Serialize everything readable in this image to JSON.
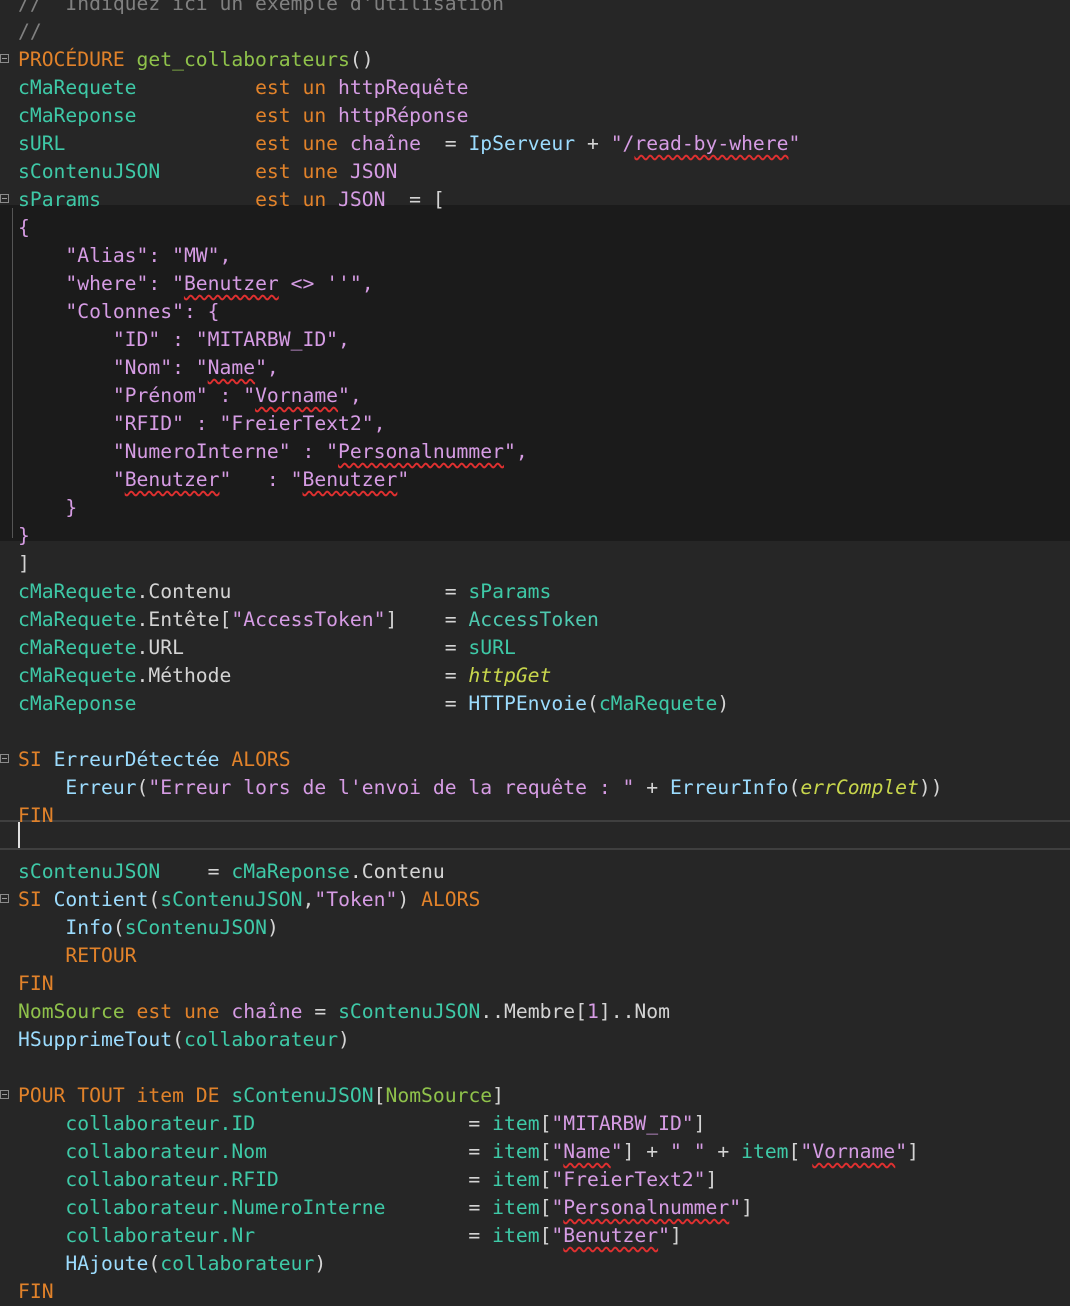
{
  "editor": {
    "lines": [
      [
        {
          "t": "//  Indiquez ici un exemple d'utilisation",
          "c": "c-cmt"
        }
      ],
      [
        {
          "t": "//",
          "c": "c-cmt"
        }
      ],
      [
        {
          "t": "PROCÉDURE ",
          "c": "c-kw"
        },
        {
          "t": "get_collaborateurs",
          "c": "c-proc"
        },
        {
          "t": "()",
          "c": "c-op"
        }
      ],
      [
        {
          "t": "cMaRequete          ",
          "c": "c-var"
        },
        {
          "t": "est un ",
          "c": "c-kw"
        },
        {
          "t": "httpRequête",
          "c": "c-str"
        }
      ],
      [
        {
          "t": "cMaReponse          ",
          "c": "c-var"
        },
        {
          "t": "est un ",
          "c": "c-kw"
        },
        {
          "t": "httpRéponse",
          "c": "c-str"
        }
      ],
      [
        {
          "t": "sURL                ",
          "c": "c-var"
        },
        {
          "t": "est une ",
          "c": "c-kw"
        },
        {
          "t": "chaîne",
          "c": "c-str"
        },
        {
          "t": "  = ",
          "c": "c-op"
        },
        {
          "t": "IpServeur",
          "c": "c-fn"
        },
        {
          "t": " + ",
          "c": "c-op"
        },
        {
          "t": "\"/",
          "c": "c-str"
        },
        {
          "t": "read-by-where",
          "c": "c-str squig"
        },
        {
          "t": "\"",
          "c": "c-str"
        }
      ],
      [
        {
          "t": "sContenuJSON        ",
          "c": "c-var"
        },
        {
          "t": "est une ",
          "c": "c-kw"
        },
        {
          "t": "JSON",
          "c": "c-str"
        }
      ],
      [
        {
          "t": "sParams             ",
          "c": "c-var"
        },
        {
          "t": "est un ",
          "c": "c-kw"
        },
        {
          "t": "JSON",
          "c": "c-str"
        },
        {
          "t": "  = [",
          "c": "c-op"
        }
      ],
      [
        {
          "t": "{",
          "c": "c-str"
        }
      ],
      [
        {
          "t": "    \"Alias\": \"MW\",",
          "c": "c-str"
        }
      ],
      [
        {
          "t": "    \"where\": \"",
          "c": "c-str"
        },
        {
          "t": "Benutzer",
          "c": "c-str squig"
        },
        {
          "t": " <> ''\",",
          "c": "c-str"
        }
      ],
      [
        {
          "t": "    \"Colonnes\": {",
          "c": "c-str"
        }
      ],
      [
        {
          "t": "        \"ID\" : \"MITARBW_ID\",",
          "c": "c-str"
        }
      ],
      [
        {
          "t": "        \"Nom\": \"",
          "c": "c-str"
        },
        {
          "t": "Name",
          "c": "c-str squig"
        },
        {
          "t": "\",",
          "c": "c-str"
        }
      ],
      [
        {
          "t": "        \"Prénom\" : \"",
          "c": "c-str"
        },
        {
          "t": "Vorname",
          "c": "c-str squig"
        },
        {
          "t": "\",",
          "c": "c-str"
        }
      ],
      [
        {
          "t": "        \"RFID\" : \"",
          "c": "c-str"
        },
        {
          "t": "FreierText2",
          "c": "c-str"
        },
        {
          "t": "\",",
          "c": "c-str"
        }
      ],
      [
        {
          "t": "        \"NumeroInterne\" : \"",
          "c": "c-str"
        },
        {
          "t": "Personalnummer",
          "c": "c-str squig"
        },
        {
          "t": "\",",
          "c": "c-str"
        }
      ],
      [
        {
          "t": "        \"",
          "c": "c-str"
        },
        {
          "t": "Benutzer",
          "c": "c-str squig"
        },
        {
          "t": "\"   : \"",
          "c": "c-str"
        },
        {
          "t": "Benutzer",
          "c": "c-str squig"
        },
        {
          "t": "\"",
          "c": "c-str"
        }
      ],
      [
        {
          "t": "    }",
          "c": "c-str"
        }
      ],
      [
        {
          "t": "}",
          "c": "c-str"
        }
      ],
      [
        {
          "t": "]",
          "c": "c-op"
        }
      ],
      [
        {
          "t": "cMaRequete",
          "c": "c-var"
        },
        {
          "t": ".Contenu                  = ",
          "c": "c-op"
        },
        {
          "t": "sParams",
          "c": "c-var"
        }
      ],
      [
        {
          "t": "cMaRequete",
          "c": "c-var"
        },
        {
          "t": ".Entête[",
          "c": "c-op"
        },
        {
          "t": "\"AccessToken\"",
          "c": "c-str"
        },
        {
          "t": "]    = ",
          "c": "c-op"
        },
        {
          "t": "AccessToken",
          "c": "c-var2"
        }
      ],
      [
        {
          "t": "cMaRequete",
          "c": "c-var"
        },
        {
          "t": ".URL                      = ",
          "c": "c-op"
        },
        {
          "t": "sURL",
          "c": "c-var"
        }
      ],
      [
        {
          "t": "cMaRequete",
          "c": "c-var"
        },
        {
          "t": ".Méthode                  = ",
          "c": "c-op"
        },
        {
          "t": "httpGet",
          "c": "c-it"
        }
      ],
      [
        {
          "t": "cMaReponse",
          "c": "c-var"
        },
        {
          "t": "                          = ",
          "c": "c-op"
        },
        {
          "t": "HTTPEnvoie",
          "c": "c-fn"
        },
        {
          "t": "(",
          "c": "c-op"
        },
        {
          "t": "cMaRequete",
          "c": "c-var"
        },
        {
          "t": ")",
          "c": "c-op"
        }
      ],
      [],
      [
        {
          "t": "SI ",
          "c": "c-kw"
        },
        {
          "t": "ErreurDétectée",
          "c": "c-fn"
        },
        {
          "t": " ALORS",
          "c": "c-kw"
        }
      ],
      [
        {
          "t": "    ",
          "c": "c-op"
        },
        {
          "t": "Erreur",
          "c": "c-fn"
        },
        {
          "t": "(",
          "c": "c-op"
        },
        {
          "t": "\"Erreur lors de l'envoi de la requête : \"",
          "c": "c-str"
        },
        {
          "t": " + ",
          "c": "c-op"
        },
        {
          "t": "ErreurInfo",
          "c": "c-fn"
        },
        {
          "t": "(",
          "c": "c-op"
        },
        {
          "t": "errComplet",
          "c": "c-it"
        },
        {
          "t": "))",
          "c": "c-op"
        }
      ],
      [
        {
          "t": "FIN",
          "c": "c-kw"
        }
      ],
      [],
      [
        {
          "t": "sContenuJSON",
          "c": "c-var"
        },
        {
          "t": "    = ",
          "c": "c-op"
        },
        {
          "t": "cMaReponse",
          "c": "c-var"
        },
        {
          "t": ".Contenu",
          "c": "c-op"
        }
      ],
      [
        {
          "t": "SI ",
          "c": "c-kw"
        },
        {
          "t": "Contient",
          "c": "c-fn"
        },
        {
          "t": "(",
          "c": "c-op"
        },
        {
          "t": "sContenuJSON",
          "c": "c-var"
        },
        {
          "t": ",",
          "c": "c-op"
        },
        {
          "t": "\"Token\"",
          "c": "c-str"
        },
        {
          "t": ") ",
          "c": "c-op"
        },
        {
          "t": "ALORS",
          "c": "c-kw"
        }
      ],
      [
        {
          "t": "    ",
          "c": "c-op"
        },
        {
          "t": "Info",
          "c": "c-fn"
        },
        {
          "t": "(",
          "c": "c-op"
        },
        {
          "t": "sContenuJSON",
          "c": "c-var"
        },
        {
          "t": ")",
          "c": "c-op"
        }
      ],
      [
        {
          "t": "    RETOUR",
          "c": "c-kw"
        }
      ],
      [
        {
          "t": "FIN",
          "c": "c-kw"
        }
      ],
      [
        {
          "t": "NomSource",
          "c": "c-proc"
        },
        {
          "t": " est une ",
          "c": "c-kw"
        },
        {
          "t": "chaîne",
          "c": "c-str"
        },
        {
          "t": " = ",
          "c": "c-op"
        },
        {
          "t": "sContenuJSON",
          "c": "c-var"
        },
        {
          "t": "..Membre[",
          "c": "c-op"
        },
        {
          "t": "1",
          "c": "c-num"
        },
        {
          "t": "]..Nom",
          "c": "c-op"
        }
      ],
      [
        {
          "t": "HSupprimeTout",
          "c": "c-fn"
        },
        {
          "t": "(",
          "c": "c-op"
        },
        {
          "t": "collaborateur",
          "c": "c-var"
        },
        {
          "t": ")",
          "c": "c-op"
        }
      ],
      [],
      [
        {
          "t": "POUR TOUT ",
          "c": "c-kw"
        },
        {
          "t": "item",
          "c": "c-kw"
        },
        {
          "t": " DE ",
          "c": "c-kw"
        },
        {
          "t": "sContenuJSON",
          "c": "c-var"
        },
        {
          "t": "[",
          "c": "c-op"
        },
        {
          "t": "NomSource",
          "c": "c-proc"
        },
        {
          "t": "]",
          "c": "c-op"
        }
      ],
      [
        {
          "t": "    ",
          "c": "c-op"
        },
        {
          "t": "collaborateur",
          "c": "c-var"
        },
        {
          "t": ".ID",
          "c": "c-var"
        },
        {
          "t": "                  = ",
          "c": "c-op"
        },
        {
          "t": "item",
          "c": "c-var"
        },
        {
          "t": "[",
          "c": "c-op"
        },
        {
          "t": "\"MITARBW_ID\"",
          "c": "c-str"
        },
        {
          "t": "]",
          "c": "c-op"
        }
      ],
      [
        {
          "t": "    ",
          "c": "c-op"
        },
        {
          "t": "collaborateur",
          "c": "c-var"
        },
        {
          "t": ".Nom",
          "c": "c-var"
        },
        {
          "t": "                 = ",
          "c": "c-op"
        },
        {
          "t": "item",
          "c": "c-var"
        },
        {
          "t": "[",
          "c": "c-op"
        },
        {
          "t": "\"",
          "c": "c-str"
        },
        {
          "t": "Name",
          "c": "c-str squig"
        },
        {
          "t": "\"",
          "c": "c-str"
        },
        {
          "t": "] + ",
          "c": "c-op"
        },
        {
          "t": "\" \"",
          "c": "c-str"
        },
        {
          "t": " + ",
          "c": "c-op"
        },
        {
          "t": "item",
          "c": "c-var"
        },
        {
          "t": "[",
          "c": "c-op"
        },
        {
          "t": "\"",
          "c": "c-str"
        },
        {
          "t": "Vorname",
          "c": "c-str squig"
        },
        {
          "t": "\"",
          "c": "c-str"
        },
        {
          "t": "]",
          "c": "c-op"
        }
      ],
      [
        {
          "t": "    ",
          "c": "c-op"
        },
        {
          "t": "collaborateur",
          "c": "c-var"
        },
        {
          "t": ".RFID",
          "c": "c-var"
        },
        {
          "t": "                = ",
          "c": "c-op"
        },
        {
          "t": "item",
          "c": "c-var"
        },
        {
          "t": "[",
          "c": "c-op"
        },
        {
          "t": "\"FreierText2\"",
          "c": "c-str"
        },
        {
          "t": "]",
          "c": "c-op"
        }
      ],
      [
        {
          "t": "    ",
          "c": "c-op"
        },
        {
          "t": "collaborateur",
          "c": "c-var"
        },
        {
          "t": ".NumeroInterne",
          "c": "c-var"
        },
        {
          "t": "       = ",
          "c": "c-op"
        },
        {
          "t": "item",
          "c": "c-var"
        },
        {
          "t": "[",
          "c": "c-op"
        },
        {
          "t": "\"",
          "c": "c-str"
        },
        {
          "t": "Personalnummer",
          "c": "c-str squig"
        },
        {
          "t": "\"",
          "c": "c-str"
        },
        {
          "t": "]",
          "c": "c-op"
        }
      ],
      [
        {
          "t": "    ",
          "c": "c-op"
        },
        {
          "t": "collaborateur",
          "c": "c-var"
        },
        {
          "t": ".Nr",
          "c": "c-var"
        },
        {
          "t": "                  = ",
          "c": "c-op"
        },
        {
          "t": "item",
          "c": "c-var"
        },
        {
          "t": "[",
          "c": "c-op"
        },
        {
          "t": "\"",
          "c": "c-str"
        },
        {
          "t": "Benutzer",
          "c": "c-str squig"
        },
        {
          "t": "\"",
          "c": "c-str"
        },
        {
          "t": "]",
          "c": "c-op"
        }
      ],
      [
        {
          "t": "    ",
          "c": "c-op"
        },
        {
          "t": "HAjoute",
          "c": "c-fn"
        },
        {
          "t": "(",
          "c": "c-op"
        },
        {
          "t": "collaborateur",
          "c": "c-var"
        },
        {
          "t": ")",
          "c": "c-op"
        }
      ],
      [
        {
          "t": "FIN",
          "c": "c-kw"
        }
      ]
    ],
    "fold_lines": [
      2,
      7,
      27,
      32,
      39
    ]
  }
}
